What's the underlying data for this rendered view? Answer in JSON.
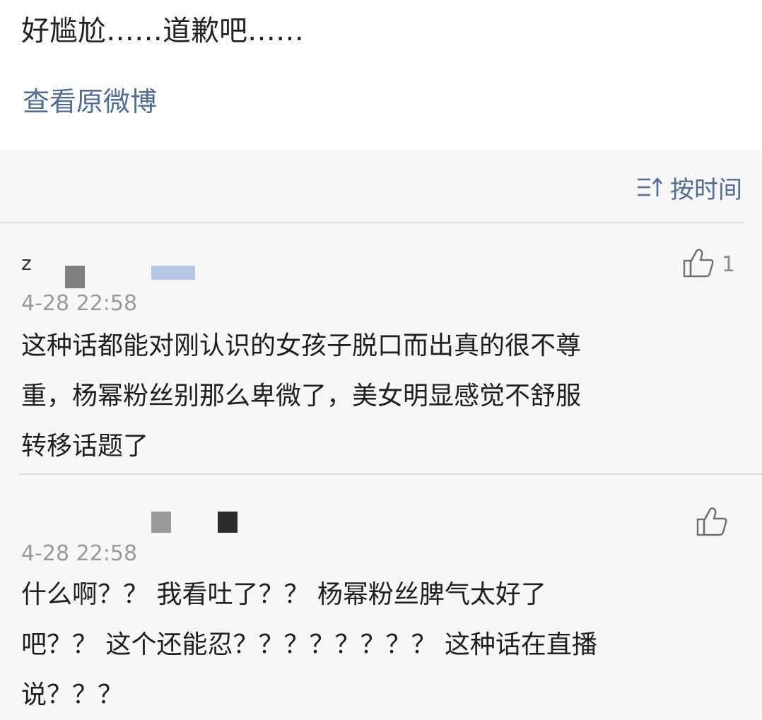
{
  "post": {
    "text": "好尴尬……道歉吧……",
    "view_original": "查看原微博"
  },
  "sort": {
    "label": "按时间",
    "icon": "sort-icon"
  },
  "comments": [
    {
      "username": "z",
      "timestamp": "4-28 22:58",
      "like_count": "1",
      "text": "这种话都能对刚认识的女孩子脱口而出真的很不尊\n重，杨幂粉丝别那么卑微了，美女明显感觉不舒服\n转移话题了"
    },
    {
      "username": "",
      "timestamp": "4-28 22:58",
      "like_count": "",
      "text": "什么啊？？ 我看吐了？？ 杨幂粉丝脾气太好了\n吧？？ 这个还能忍？？？？？？？？ 这种话在直播\n说？？？"
    }
  ],
  "colors": {
    "link": "#506e95",
    "background_comments": "#f7f7f7",
    "timestamp": "#9a9a9a"
  }
}
